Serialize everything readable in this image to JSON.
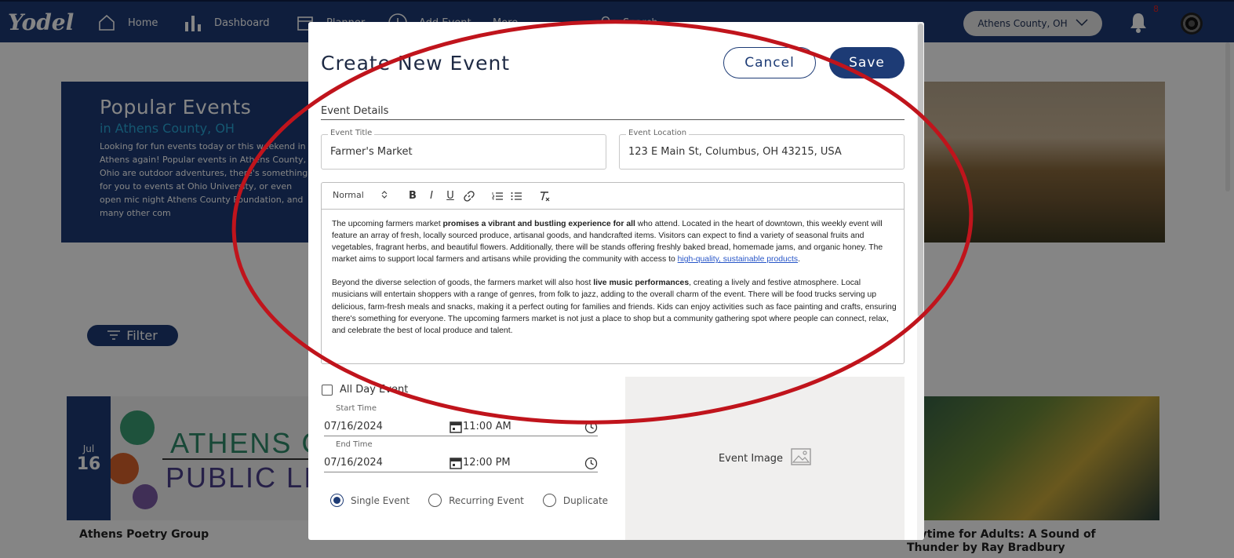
{
  "app": {
    "name": "Yodel"
  },
  "nav": {
    "items": [
      {
        "label": "Home"
      },
      {
        "label": "Dashboard"
      },
      {
        "label": "Planner"
      },
      {
        "label": "Add Event"
      },
      {
        "label": "More"
      }
    ],
    "search_placeholder": "Search",
    "location": "Athens County, OH",
    "notification_count": "8"
  },
  "hero": {
    "title": "Popular Events",
    "subtitle": "in Athens County, OH",
    "text": "Looking for fun events today or this weekend in Athens again! Popular events in Athens County, Ohio are outdoor adventures, there's something for you to events at Ohio University, or even open mic night Athens County Foundation, and many other com"
  },
  "filter_label": "Filter",
  "cards": [
    {
      "month": "Jul",
      "day": "16",
      "title": "Athens Poetry Group",
      "image_text_1": "ATHENS C",
      "image_text_2": "PUBLIC LIB"
    },
    {
      "title": "orytime for Adults: A Sound of Thunder by Ray Bradbury"
    }
  ],
  "modal": {
    "title": "Create New Event",
    "cancel_label": "Cancel",
    "save_label": "Save",
    "section_label": "Event Details",
    "event_title": {
      "label": "Event Title",
      "value": "Farmer's Market"
    },
    "event_location": {
      "label": "Event Location",
      "value": "123 E Main St, Columbus, OH 43215, USA"
    },
    "editor": {
      "format_select": "Normal",
      "p1_a": "The upcoming farmers market ",
      "p1_b": "promises a vibrant and bustling experience for all",
      "p1_c": " who attend. Located in the heart of downtown, this weekly event will feature an array of fresh, locally sourced produce, artisanal goods, and handcrafted items. Visitors can expect to find a variety of seasonal fruits and vegetables, fragrant herbs, and beautiful flowers. Additionally, there will be stands offering freshly baked bread, homemade jams, and organic honey. The market aims to support local farmers and artisans while providing the community with access to ",
      "p1_link": "high-quality, sustainable products",
      "p1_d": ".",
      "p2_a": "Beyond the diverse selection of goods, the farmers market will also host ",
      "p2_b": "live music performances",
      "p2_c": ", creating a lively and festive atmosphere. Local musicians will entertain shoppers with a range of genres, from folk to jazz, adding to the overall charm of the event. There will be food trucks serving up delicious, farm-fresh meals and snacks, making it a perfect outing for families and friends. Kids can enjoy activities such as face painting and crafts, ensuring there's something for everyone. The upcoming farmers market is not just a place to shop but a community gathering spot where people can connect, relax, and celebrate the best of local produce and talent."
    },
    "all_day_label": "All Day Event",
    "start": {
      "label": "Start Time",
      "date": "07/16/2024",
      "time": "11:00 AM"
    },
    "end": {
      "label": "End Time",
      "date": "07/16/2024",
      "time": "12:00 PM"
    },
    "recurrence": {
      "options": [
        "Single Event",
        "Recurring Event",
        "Duplicate"
      ],
      "selected": "Single Event"
    },
    "image_label": "Event Image"
  },
  "colors": {
    "brand": "#1d3b75",
    "accent": "#29a8d8",
    "annotation": "#c0141c"
  }
}
